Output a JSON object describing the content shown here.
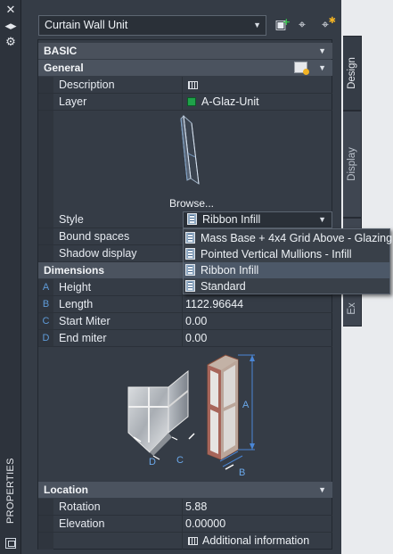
{
  "window": {
    "title": "PROPERTIES",
    "buttons": {
      "close": "✕",
      "pin": "◂▸",
      "options": "⚙"
    }
  },
  "header": {
    "object_selector": "Curtain Wall Unit",
    "toolbar_icons": [
      "add-style-icon",
      "select-objects-icon",
      "quick-select-icon"
    ]
  },
  "sections": {
    "basic": "BASIC",
    "general": "General",
    "dimensions": "Dimensions",
    "location": "Location"
  },
  "general": {
    "description_label": "Description",
    "layer_label": "Layer",
    "layer_value": "A-Glaz-Unit",
    "layer_color": "#1fa24a",
    "browse_label": "Browse...",
    "style_label": "Style",
    "style_value": "Ribbon Infill",
    "bound_spaces_label": "Bound spaces",
    "shadow_display_label": "Shadow display"
  },
  "style_dropdown": {
    "options": [
      "Mass Base + 4x4 Grid Above - Glazing",
      "Pointed Vertical Mullions - Infill",
      "Ribbon Infill",
      "Standard"
    ],
    "selected": "Ribbon Infill"
  },
  "dimensions": [
    {
      "letter": "A",
      "label": "Height",
      "value": ""
    },
    {
      "letter": "B",
      "label": "Length",
      "value": "1122.96644"
    },
    {
      "letter": "C",
      "label": "Start Miter",
      "value": "0.00"
    },
    {
      "letter": "D",
      "label": "End miter",
      "value": "0.00"
    }
  ],
  "illustration_labels": {
    "a": "A",
    "b": "B",
    "c": "C",
    "d": "D"
  },
  "location": {
    "rotation_label": "Rotation",
    "rotation_value": "5.88",
    "elevation_label": "Elevation",
    "elevation_value": "0.00000",
    "additional_info": "Additional information"
  },
  "side_tabs": [
    "Design",
    "Display",
    "Ex"
  ],
  "colors": {
    "panel": "#353c46",
    "section": "#4b535f",
    "accent_letter": "#5f9bd8",
    "dim_line": "#4a86d6"
  }
}
